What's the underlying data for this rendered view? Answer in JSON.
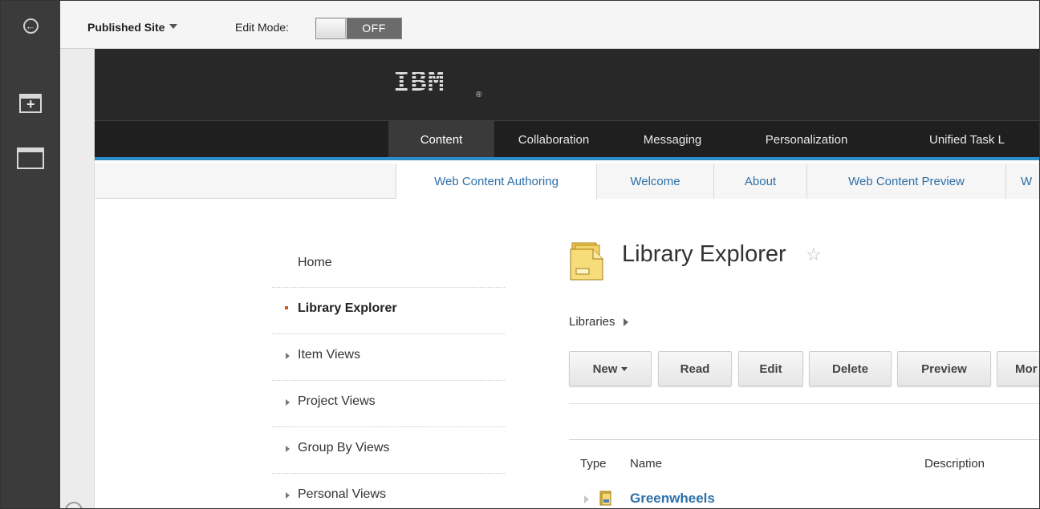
{
  "toolbar": {
    "site_selector": "Published Site",
    "edit_mode_label": "Edit Mode:",
    "edit_mode_state": "OFF"
  },
  "left_toolbar": {
    "icons": [
      "back-arrow-icon",
      "add-content-icon",
      "page-icon"
    ]
  },
  "banner": {
    "logo_text": "IBM",
    "logo_mark": "®"
  },
  "main_nav": {
    "items": [
      {
        "label": "Content",
        "active": true
      },
      {
        "label": "Collaboration",
        "active": false
      },
      {
        "label": "Messaging",
        "active": false
      },
      {
        "label": "Personalization",
        "active": false
      },
      {
        "label": "Unified Task L",
        "active": false
      }
    ]
  },
  "sub_nav": {
    "tabs": [
      {
        "label": "Web Content Authoring",
        "active": true
      },
      {
        "label": "Welcome",
        "active": false
      },
      {
        "label": "About",
        "active": false
      },
      {
        "label": "Web Content Preview",
        "active": false
      },
      {
        "label": "W",
        "active": false
      }
    ]
  },
  "side_nav": {
    "items": [
      {
        "label": "Home"
      },
      {
        "label": "Library Explorer"
      },
      {
        "label": "Item Views"
      },
      {
        "label": "Project Views"
      },
      {
        "label": "Group By Views"
      },
      {
        "label": "Personal Views"
      }
    ]
  },
  "page": {
    "title": "Library Explorer",
    "breadcrumb": "Libraries"
  },
  "actions": {
    "new": "New",
    "read": "Read",
    "edit": "Edit",
    "delete": "Delete",
    "preview": "Preview",
    "more": "Mor"
  },
  "table": {
    "headers": {
      "type": "Type",
      "name": "Name",
      "description": "Description"
    },
    "rows": [
      {
        "name": "Greenwheels"
      }
    ]
  },
  "colors": {
    "accent": "#2c8cc9",
    "link": "#2d6fa8",
    "active_bullet": "#d4541c",
    "banner_bg": "#282828"
  }
}
